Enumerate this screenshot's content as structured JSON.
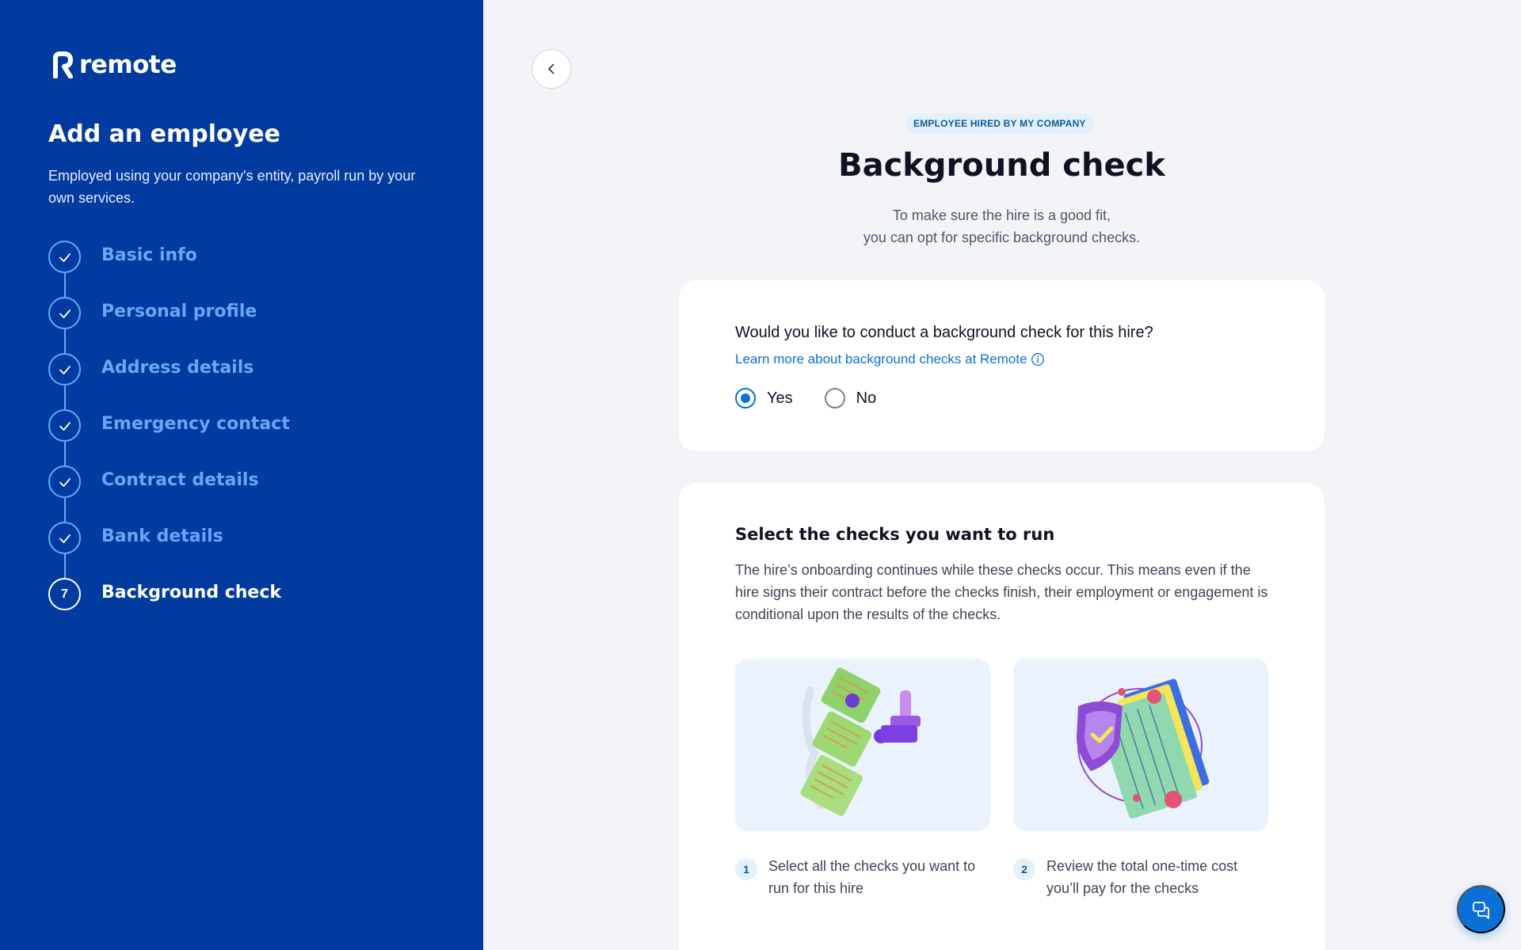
{
  "brand": {
    "name": "remote"
  },
  "sidebar": {
    "title": "Add an employee",
    "description": "Employed using your company's entity, payroll run by your own services.",
    "steps": [
      {
        "label": "Basic info",
        "status": "done"
      },
      {
        "label": "Personal profile",
        "status": "done"
      },
      {
        "label": "Address details",
        "status": "done"
      },
      {
        "label": "Emergency contact",
        "status": "done"
      },
      {
        "label": "Contract details",
        "status": "done"
      },
      {
        "label": "Bank details",
        "status": "done"
      },
      {
        "label": "Background check",
        "status": "current",
        "number": "7"
      }
    ]
  },
  "main": {
    "eyebrow": "EMPLOYEE HIRED BY MY COMPANY",
    "title": "Background check",
    "subtitle_line1": "To make sure the hire is a good fit,",
    "subtitle_line2": "you can opt for specific background checks.",
    "question_card": {
      "question": "Would you like to conduct a background check for this hire?",
      "learn_more": "Learn more about background checks at Remote",
      "options": [
        {
          "label": "Yes",
          "selected": true
        },
        {
          "label": "No",
          "selected": false
        }
      ]
    },
    "checks_card": {
      "title": "Select the checks you want to run",
      "description": "The hire’s onboarding continues while these checks occur. This means even if the hire signs their contract before the checks finish, their employment or engagement is conditional upon the results of the checks.",
      "steps": [
        {
          "number": "1",
          "text": "Select all the checks you want to run for this hire"
        },
        {
          "number": "2",
          "text": "Review the total one-time cost you’ll pay for the checks"
        }
      ]
    }
  },
  "colors": {
    "sidebar_bg": "#023b9f",
    "accent": "#0b6fd8",
    "step_done": "#63a9f6",
    "page_bg": "#f3f4f8"
  },
  "icons": {
    "back": "chevron-left-icon",
    "done": "check-icon",
    "info": "info-icon",
    "chat": "chat-icon"
  }
}
